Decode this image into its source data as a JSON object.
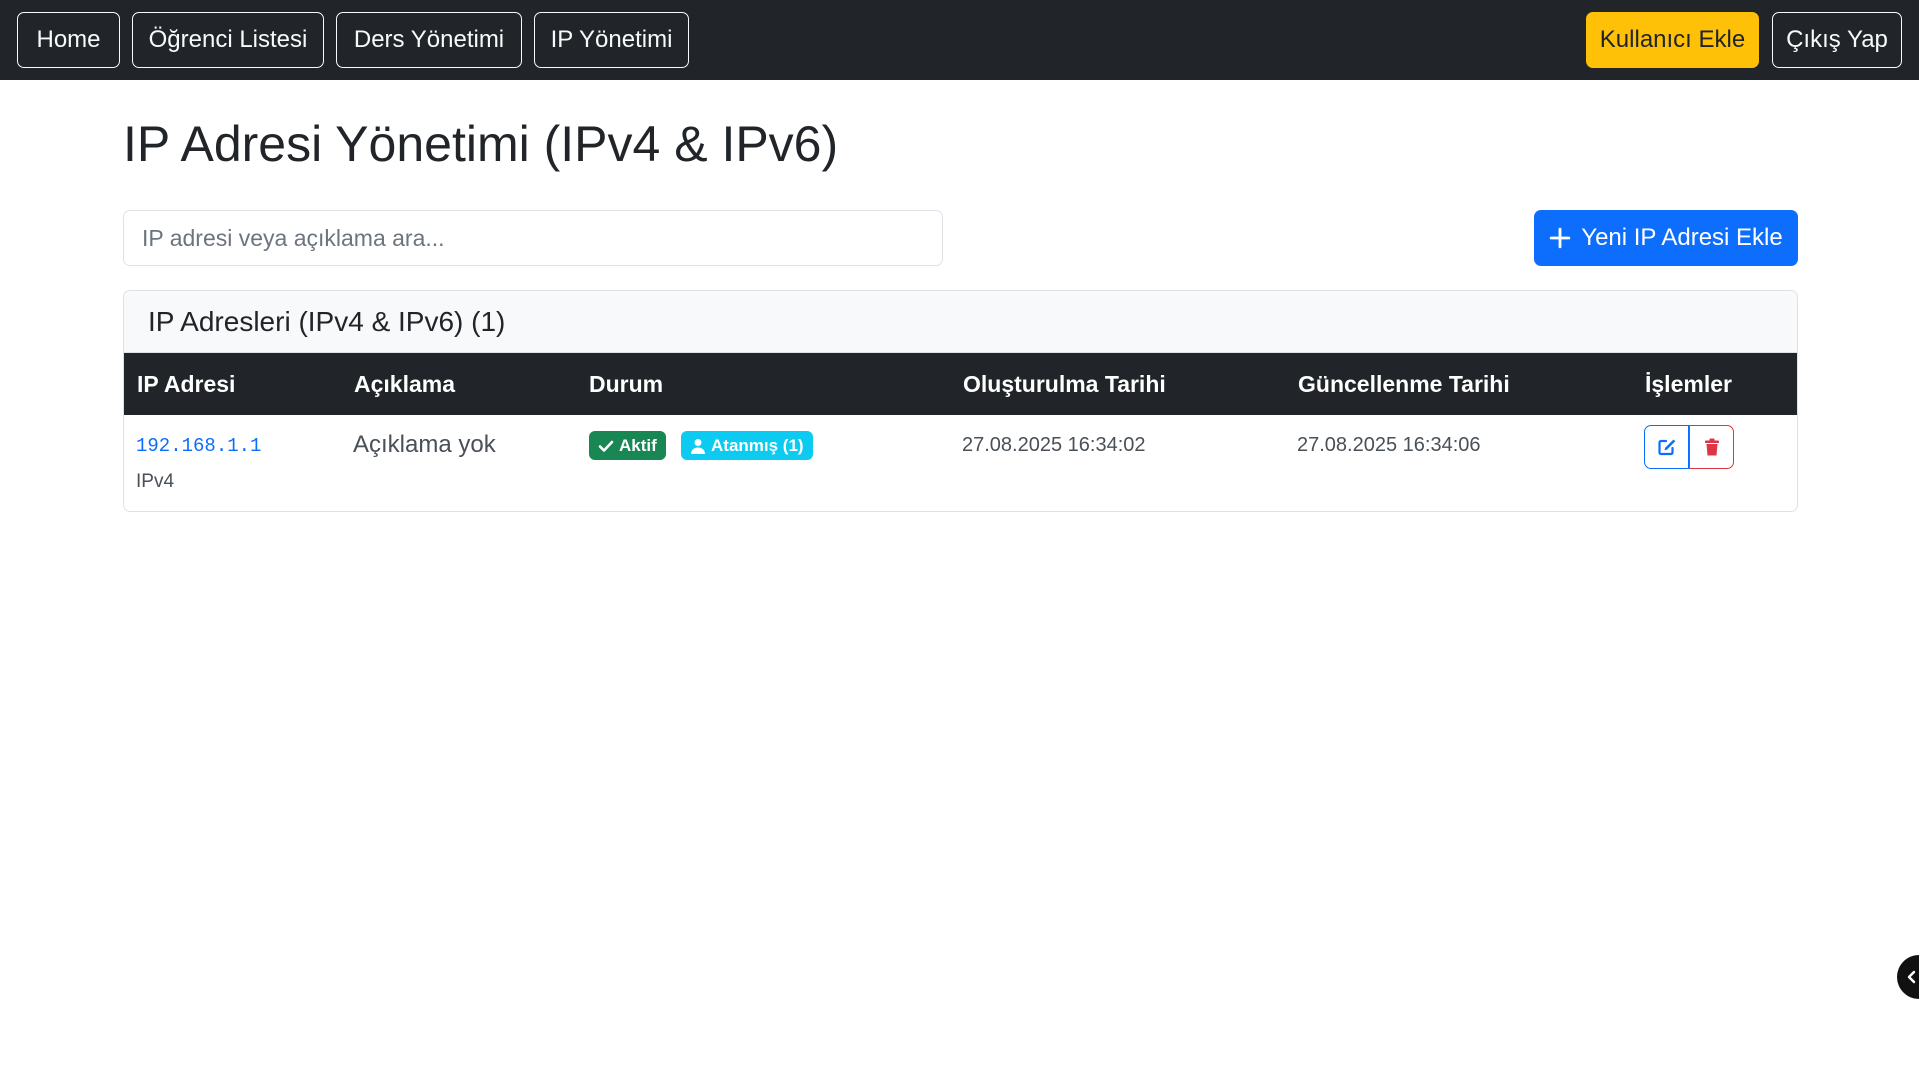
{
  "navbar": {
    "left_items": [
      "Home",
      "Öğrenci Listesi",
      "Ders Yönetimi",
      "IP Yönetimi"
    ],
    "add_user_label": "Kullanıcı Ekle",
    "logout_label": "Çıkış Yap"
  },
  "page": {
    "title": "IP Adresi Yönetimi (IPv4 & IPv6)"
  },
  "search": {
    "placeholder": "IP adresi veya açıklama ara...",
    "value": ""
  },
  "toolbar": {
    "add_button_label": "Yeni IP Adresi Ekle"
  },
  "card": {
    "header": "IP Adresleri (IPv4 & IPv6) (1)"
  },
  "table": {
    "columns": [
      "IP Adresi",
      "Açıklama",
      "Durum",
      "Oluşturulma Tarihi",
      "Güncellenme Tarihi",
      "İşlemler"
    ],
    "rows": [
      {
        "ip": "192.168.1.1",
        "ip_type": "IPv4",
        "description": "Açıklama yok",
        "status_badge": "Aktif",
        "assigned_badge": "Atanmış (1)",
        "created": "27.08.2025 16:34:02",
        "updated": "27.08.2025 16:34:06"
      }
    ]
  },
  "colors": {
    "navbar_bg": "#212529",
    "primary": "#0d6efd",
    "warning": "#ffc107",
    "success": "#198754",
    "info": "#0dcaf0",
    "danger": "#dc3545"
  },
  "icons": {
    "add": "plus-icon",
    "active": "check-icon",
    "assigned": "user-icon",
    "edit": "edit-icon",
    "delete": "trash-icon",
    "side_toggle": "chevron-left-icon"
  }
}
